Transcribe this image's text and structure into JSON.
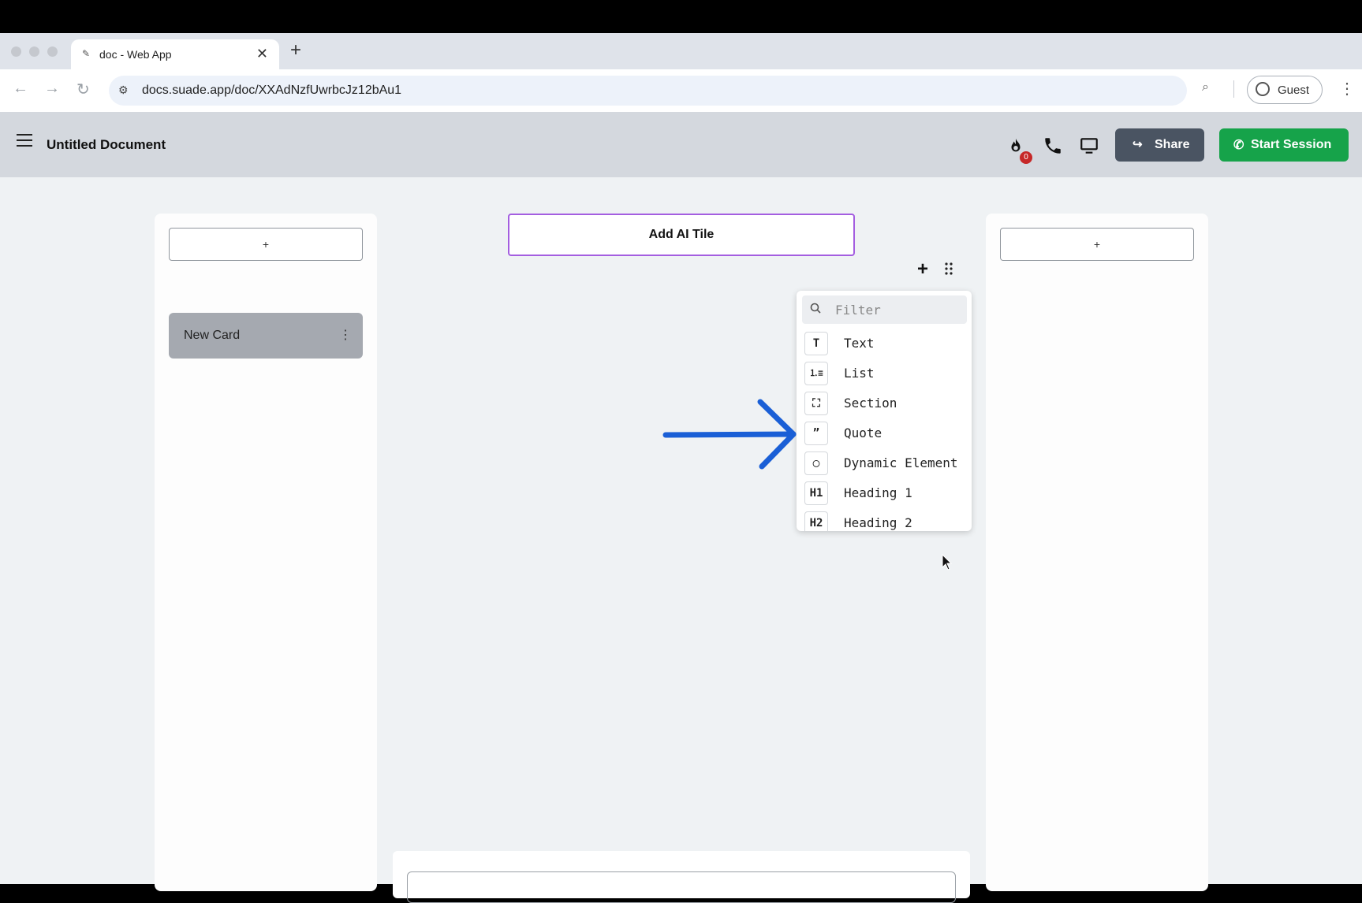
{
  "browser": {
    "tab_title": "doc - Web App",
    "url": "docs.suade.app/doc/XXAdNzfUwrbcJz12bAu1",
    "profile_label": "Guest"
  },
  "app": {
    "doc_title": "Untitled Document",
    "notification_count": "0",
    "share_label": "Share",
    "start_session_label": "Start Session",
    "accent_green": "#16a34a",
    "share_bg": "#4a5462"
  },
  "left_column": {
    "add_label": "+",
    "card_label": "New Card",
    "card_menu": "⋮"
  },
  "center": {
    "ai_tile_label": "Add AI Tile",
    "ai_tile_border": "#a45ee0",
    "add_block_label": "+"
  },
  "block_menu": {
    "filter_placeholder": "Filter",
    "items": [
      {
        "icon": "T",
        "icon_name": "text-icon",
        "label": "Text"
      },
      {
        "icon": "⒈≡",
        "icon_name": "list-icon",
        "label": "List"
      },
      {
        "icon": "⛶",
        "icon_name": "section-icon",
        "label": "Section"
      },
      {
        "icon": "”",
        "icon_name": "quote-icon",
        "label": "Quote"
      },
      {
        "icon": "◯",
        "icon_name": "dynamic-element-icon",
        "label": "Dynamic Element"
      },
      {
        "icon": "H1",
        "icon_name": "heading-1-icon",
        "label": "Heading 1"
      },
      {
        "icon": "H2",
        "icon_name": "heading-2-icon",
        "label": "Heading 2"
      }
    ]
  },
  "right_column": {
    "add_label": "+"
  },
  "annotation": {
    "arrow_color": "#1a5fd6"
  }
}
